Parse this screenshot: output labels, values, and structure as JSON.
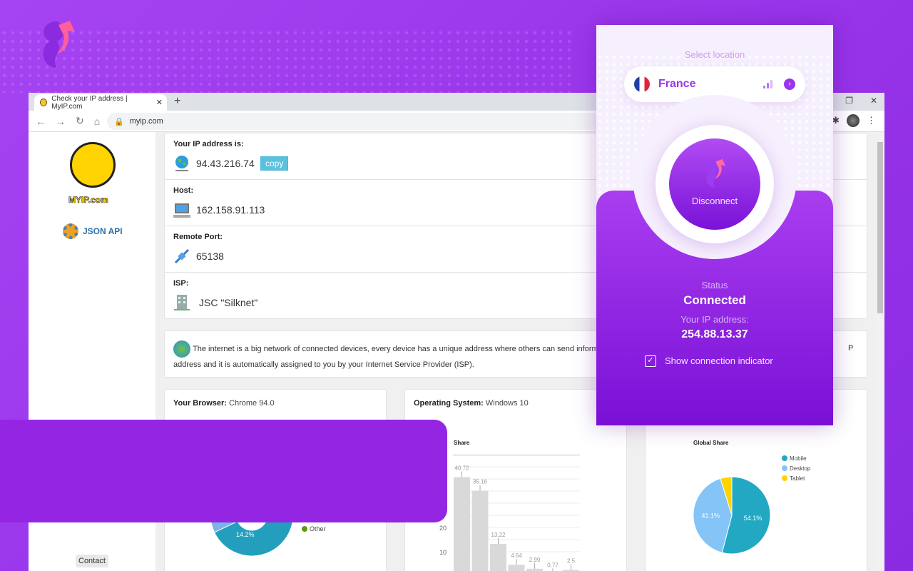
{
  "browser": {
    "tab_title": "Check your IP address | MyIP.com",
    "url": "myip.com"
  },
  "site": {
    "logo_text": "MYIP.com",
    "json_api": "JSON API",
    "contact": "Contact",
    "ip_rows": [
      {
        "label": "Your IP address is:",
        "value": "94.43.216.74",
        "icon": "globe-network-icon"
      },
      {
        "label": "Host:",
        "value": "162.158.91.113",
        "icon": "computer-icon"
      },
      {
        "label": "Remote Port:",
        "value": "65138",
        "icon": "plug-icon"
      },
      {
        "label": "ISP:",
        "value": "JSC \"Silknet\"",
        "icon": "building-icon"
      }
    ],
    "copy_label": "copy",
    "info_line1": "The internet is a big network of connected devices, every device has a unique address where others can send inform",
    "info_line2": "address and it is automatically assigned to you by your Internet Service Provider (ISP).",
    "info_tail": "P",
    "browser_label": "Your Browser:",
    "browser_value": "Chrome 94.0",
    "os_label": "Operating System:",
    "os_value": "Windows 10"
  },
  "chart_data": [
    {
      "type": "pie",
      "variant": "donut",
      "visible_labels": [
        "14.2%"
      ],
      "legend": [
        "Other"
      ],
      "colors": [
        "#239fbd",
        "#7ab3e6",
        "#e8c10a",
        "#5a9a0a"
      ]
    },
    {
      "type": "bar",
      "title": "Share",
      "y_ticks": [
        10,
        20
      ],
      "values": [
        40.72,
        35.16,
        13.22,
        4.64,
        2.99,
        0.77,
        2.5
      ]
    },
    {
      "type": "pie",
      "title": "Global Share",
      "categories": [
        "Mobile",
        "Desktop",
        "Tablet"
      ],
      "values": [
        54.1,
        41.1,
        4.8
      ],
      "labels": [
        "54.1%",
        "41.1%",
        ""
      ],
      "colors": [
        "#23a8c3",
        "#84c4f7",
        "#fed300"
      ],
      "legend": "top-right"
    }
  ],
  "vpn": {
    "select_location": "Select location",
    "country": "France",
    "button": "Disconnect",
    "status_label": "Status",
    "status": "Connected",
    "ip_label": "Your IP address:",
    "ip": "254.88.13.37",
    "indicator_label": "Show connection indicator",
    "indicator_checked": true,
    "accent": "#9a35ea"
  }
}
